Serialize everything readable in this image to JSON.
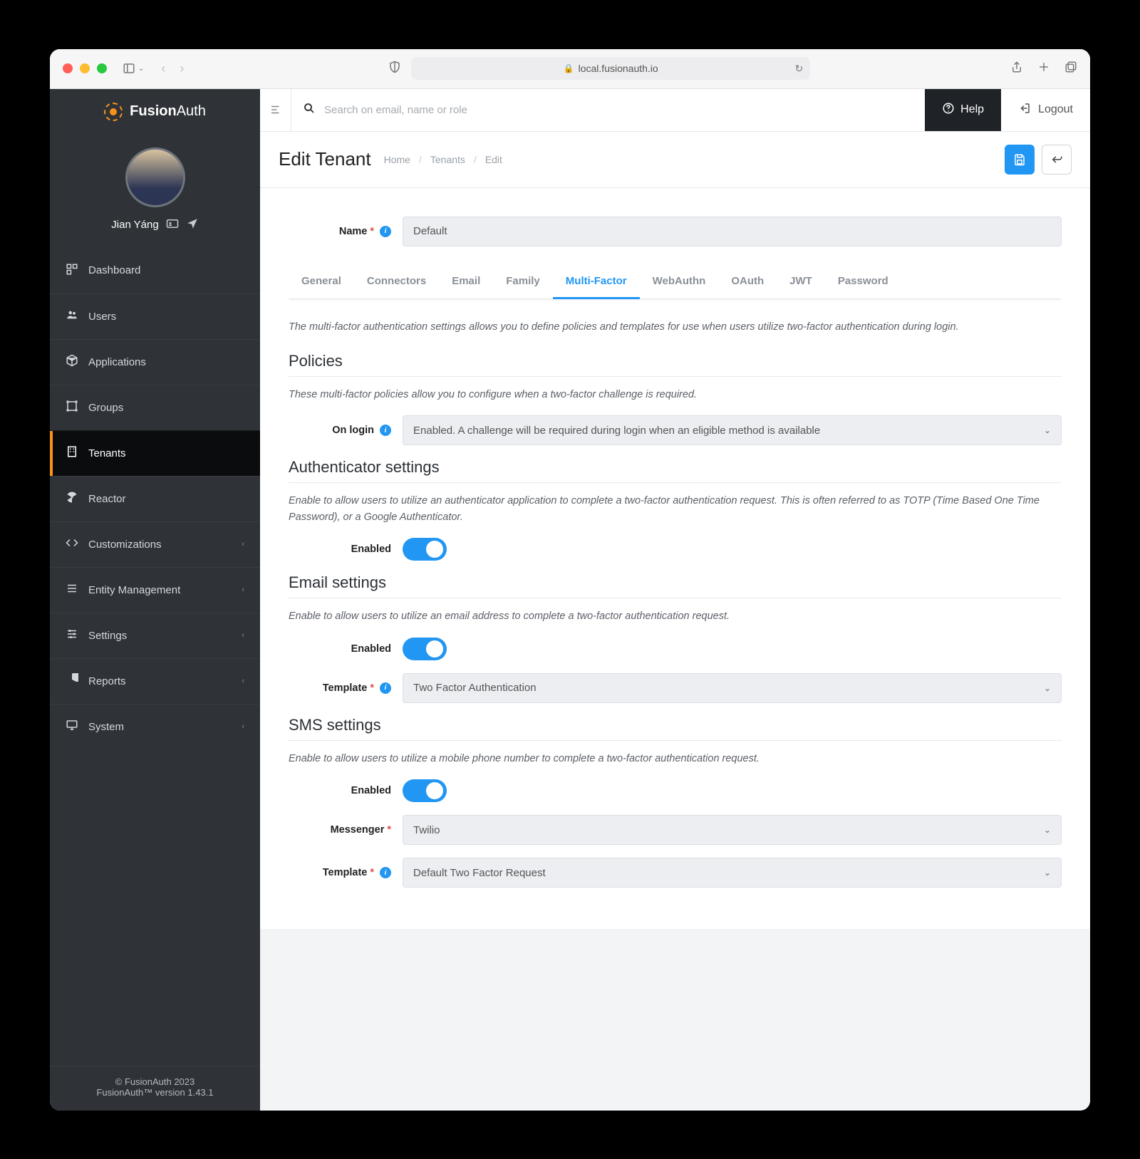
{
  "browser": {
    "url": "local.fusionauth.io"
  },
  "brand": {
    "name_a": "Fusion",
    "name_b": "Auth"
  },
  "user": {
    "name": "Jian Yáng"
  },
  "sidebar": {
    "items": [
      {
        "label": "Dashboard"
      },
      {
        "label": "Users"
      },
      {
        "label": "Applications"
      },
      {
        "label": "Groups"
      },
      {
        "label": "Tenants"
      },
      {
        "label": "Reactor"
      },
      {
        "label": "Customizations"
      },
      {
        "label": "Entity Management"
      },
      {
        "label": "Settings"
      },
      {
        "label": "Reports"
      },
      {
        "label": "System"
      }
    ],
    "footer_copyright": "© FusionAuth 2023",
    "footer_version": "FusionAuth™ version 1.43.1"
  },
  "topbar": {
    "search_placeholder": "Search on email, name or role",
    "help": "Help",
    "logout": "Logout"
  },
  "header": {
    "title": "Edit Tenant",
    "crumbs": [
      "Home",
      "Tenants",
      "Edit"
    ]
  },
  "form": {
    "name_label": "Name",
    "name_value": "Default",
    "tabs": [
      "General",
      "Connectors",
      "Email",
      "Family",
      "Multi-Factor",
      "WebAuthn",
      "OAuth",
      "JWT",
      "Password"
    ],
    "active_tab": "Multi-Factor",
    "intro": "The multi-factor authentication settings allows you to define policies and templates for use when users utilize two-factor authentication during login.",
    "policies": {
      "heading": "Policies",
      "desc": "These multi-factor policies allow you to configure when a two-factor challenge is required.",
      "on_login_label": "On login",
      "on_login_value": "Enabled. A challenge will be required during login when an eligible method is available"
    },
    "authenticator": {
      "heading": "Authenticator settings",
      "desc": "Enable to allow users to utilize an authenticator application to complete a two-factor authentication request. This is often referred to as TOTP (Time Based One Time Password), or a Google Authenticator.",
      "enabled_label": "Enabled"
    },
    "email": {
      "heading": "Email settings",
      "desc": "Enable to allow users to utilize an email address to complete a two-factor authentication request.",
      "enabled_label": "Enabled",
      "template_label": "Template",
      "template_value": "Two Factor Authentication"
    },
    "sms": {
      "heading": "SMS settings",
      "desc": "Enable to allow users to utilize a mobile phone number to complete a two-factor authentication request.",
      "enabled_label": "Enabled",
      "messenger_label": "Messenger",
      "messenger_value": "Twilio",
      "template_label": "Template",
      "template_value": "Default Two Factor Request"
    }
  }
}
